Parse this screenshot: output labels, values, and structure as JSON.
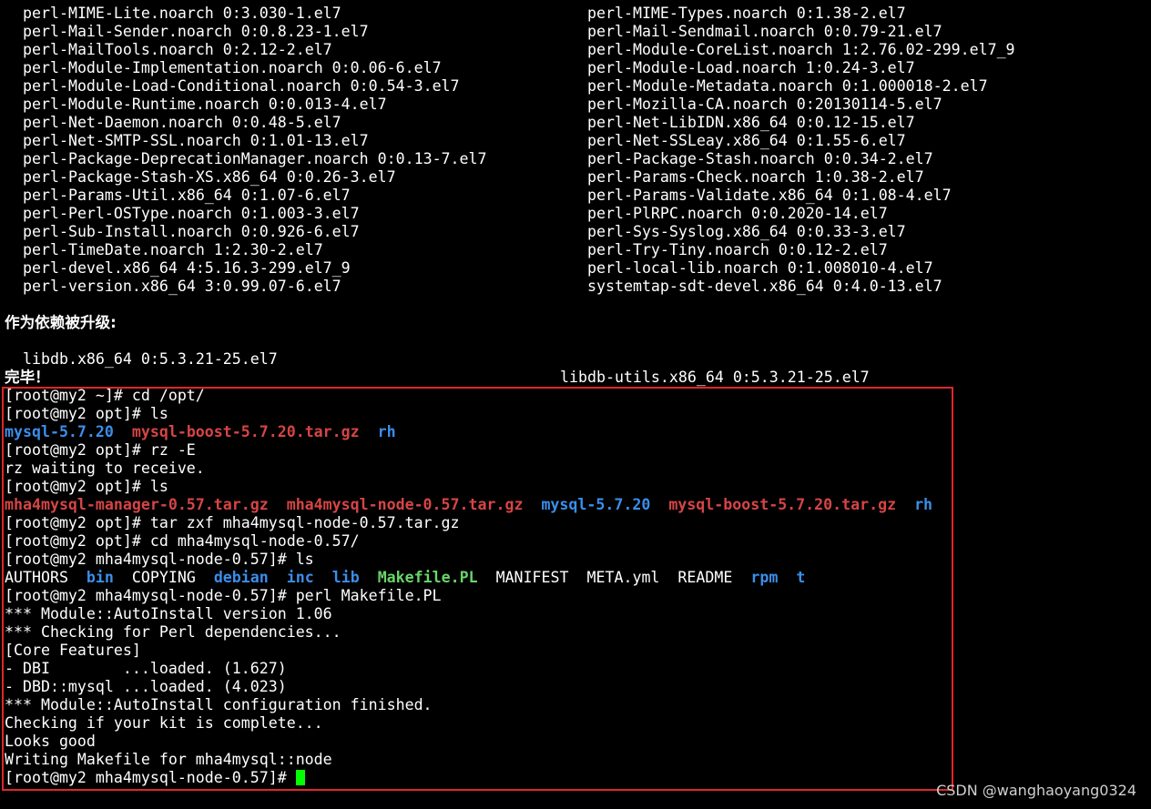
{
  "packages_updated": [
    [
      "perl-MIME-Lite.noarch 0:3.030-1.el7",
      "perl-MIME-Types.noarch 0:1.38-2.el7"
    ],
    [
      "perl-Mail-Sender.noarch 0:0.8.23-1.el7",
      "perl-Mail-Sendmail.noarch 0:0.79-21.el7"
    ],
    [
      "perl-MailTools.noarch 0:2.12-2.el7",
      "perl-Module-CoreList.noarch 1:2.76.02-299.el7_9"
    ],
    [
      "perl-Module-Implementation.noarch 0:0.06-6.el7",
      "perl-Module-Load.noarch 1:0.24-3.el7"
    ],
    [
      "perl-Module-Load-Conditional.noarch 0:0.54-3.el7",
      "perl-Module-Metadata.noarch 0:1.000018-2.el7"
    ],
    [
      "perl-Module-Runtime.noarch 0:0.013-4.el7",
      "perl-Mozilla-CA.noarch 0:20130114-5.el7"
    ],
    [
      "perl-Net-Daemon.noarch 0:0.48-5.el7",
      "perl-Net-LibIDN.x86_64 0:0.12-15.el7"
    ],
    [
      "perl-Net-SMTP-SSL.noarch 0:1.01-13.el7",
      "perl-Net-SSLeay.x86_64 0:1.55-6.el7"
    ],
    [
      "perl-Package-DeprecationManager.noarch 0:0.13-7.el7",
      "perl-Package-Stash.noarch 0:0.34-2.el7"
    ],
    [
      "perl-Package-Stash-XS.x86_64 0:0.26-3.el7",
      "perl-Params-Check.noarch 1:0.38-2.el7"
    ],
    [
      "perl-Params-Util.x86_64 0:1.07-6.el7",
      "perl-Params-Validate.x86_64 0:1.08-4.el7"
    ],
    [
      "perl-Perl-OSType.noarch 0:1.003-3.el7",
      "perl-PlRPC.noarch 0:0.2020-14.el7"
    ],
    [
      "perl-Sub-Install.noarch 0:0.926-6.el7",
      "perl-Sys-Syslog.x86_64 0:0.33-3.el7"
    ],
    [
      "perl-TimeDate.noarch 1:2.30-2.el7",
      "perl-Try-Tiny.noarch 0:0.12-2.el7"
    ],
    [
      "perl-devel.x86_64 4:5.16.3-299.el7_9",
      "perl-local-lib.noarch 0:1.008010-4.el7"
    ],
    [
      "perl-version.x86_64 3:0.99.07-6.el7",
      "systemtap-sdt-devel.x86_64 0:4.0-13.el7"
    ]
  ],
  "dependency_header": "作为依赖被升级:",
  "dependency_packages": [
    "libdb.x86_64 0:5.3.21-25.el7",
    "libdb-utils.x86_64 0:5.3.21-25.el7"
  ],
  "done_text": "完毕！",
  "session_lines": [
    [
      {
        "t": "[root@my2 ~]# cd /opt/",
        "c": "white"
      }
    ],
    [
      {
        "t": "[root@my2 opt]# ls",
        "c": "white"
      }
    ],
    [
      {
        "t": "mysql-5.7.20",
        "c": "blue"
      },
      {
        "t": "  ",
        "c": "white"
      },
      {
        "t": "mysql-boost-5.7.20.tar.gz",
        "c": "red"
      },
      {
        "t": "  ",
        "c": "white"
      },
      {
        "t": "rh",
        "c": "blue"
      }
    ],
    [
      {
        "t": "[root@my2 opt]# rz -E",
        "c": "white"
      }
    ],
    [
      {
        "t": "rz waiting to receive.",
        "c": "white"
      }
    ],
    [
      {
        "t": "[root@my2 opt]# ls",
        "c": "white"
      }
    ],
    [
      {
        "t": "mha4mysql-manager-0.57.tar.gz",
        "c": "red"
      },
      {
        "t": "  ",
        "c": "white"
      },
      {
        "t": "mha4mysql-node-0.57.tar.gz",
        "c": "red"
      },
      {
        "t": "  ",
        "c": "white"
      },
      {
        "t": "mysql-5.7.20",
        "c": "blue"
      },
      {
        "t": "  ",
        "c": "white"
      },
      {
        "t": "mysql-boost-5.7.20.tar.gz",
        "c": "red"
      },
      {
        "t": "  ",
        "c": "white"
      },
      {
        "t": "rh",
        "c": "blue"
      }
    ],
    [
      {
        "t": "[root@my2 opt]# tar zxf mha4mysql-node-0.57.tar.gz",
        "c": "white"
      }
    ],
    [
      {
        "t": "[root@my2 opt]# cd mha4mysql-node-0.57/",
        "c": "white"
      }
    ],
    [
      {
        "t": "[root@my2 mha4mysql-node-0.57]# ls",
        "c": "white"
      }
    ],
    [
      {
        "t": "AUTHORS",
        "c": "white"
      },
      {
        "t": "  ",
        "c": "white"
      },
      {
        "t": "bin",
        "c": "blue"
      },
      {
        "t": "  ",
        "c": "white"
      },
      {
        "t": "COPYING",
        "c": "white"
      },
      {
        "t": "  ",
        "c": "white"
      },
      {
        "t": "debian",
        "c": "blue"
      },
      {
        "t": "  ",
        "c": "white"
      },
      {
        "t": "inc",
        "c": "blue"
      },
      {
        "t": "  ",
        "c": "white"
      },
      {
        "t": "lib",
        "c": "blue"
      },
      {
        "t": "  ",
        "c": "white"
      },
      {
        "t": "Makefile.PL",
        "c": "green"
      },
      {
        "t": "  ",
        "c": "white"
      },
      {
        "t": "MANIFEST",
        "c": "white"
      },
      {
        "t": "  ",
        "c": "white"
      },
      {
        "t": "META.yml",
        "c": "white"
      },
      {
        "t": "  ",
        "c": "white"
      },
      {
        "t": "README",
        "c": "white"
      },
      {
        "t": "  ",
        "c": "white"
      },
      {
        "t": "rpm",
        "c": "blue"
      },
      {
        "t": "  ",
        "c": "white"
      },
      {
        "t": "t",
        "c": "blue"
      }
    ],
    [
      {
        "t": "[root@my2 mha4mysql-node-0.57]# perl Makefile.PL",
        "c": "white"
      }
    ],
    [
      {
        "t": "*** Module::AutoInstall version 1.06",
        "c": "white"
      }
    ],
    [
      {
        "t": "*** Checking for Perl dependencies...",
        "c": "white"
      }
    ],
    [
      {
        "t": "[Core Features]",
        "c": "white"
      }
    ],
    [
      {
        "t": "- DBI        ...loaded. (1.627)",
        "c": "white"
      }
    ],
    [
      {
        "t": "- DBD::mysql ...loaded. (4.023)",
        "c": "white"
      }
    ],
    [
      {
        "t": "*** Module::AutoInstall configuration finished.",
        "c": "white"
      }
    ],
    [
      {
        "t": "Checking if your kit is complete...",
        "c": "white"
      }
    ],
    [
      {
        "t": "Looks good",
        "c": "white"
      }
    ],
    [
      {
        "t": "Writing Makefile for mha4mysql::node",
        "c": "white"
      }
    ],
    [
      {
        "t": "[root@my2 mha4mysql-node-0.57]# ",
        "c": "white"
      }
    ]
  ],
  "watermark": "CSDN @wanghaoyang0324",
  "colors": {
    "background": "#000000",
    "text": "#ffffff",
    "directory": "#3b8eea",
    "archive": "#d64545",
    "executable": "#6ad46a",
    "highlight_border": "#e0262b",
    "cursor": "#00ff00"
  }
}
